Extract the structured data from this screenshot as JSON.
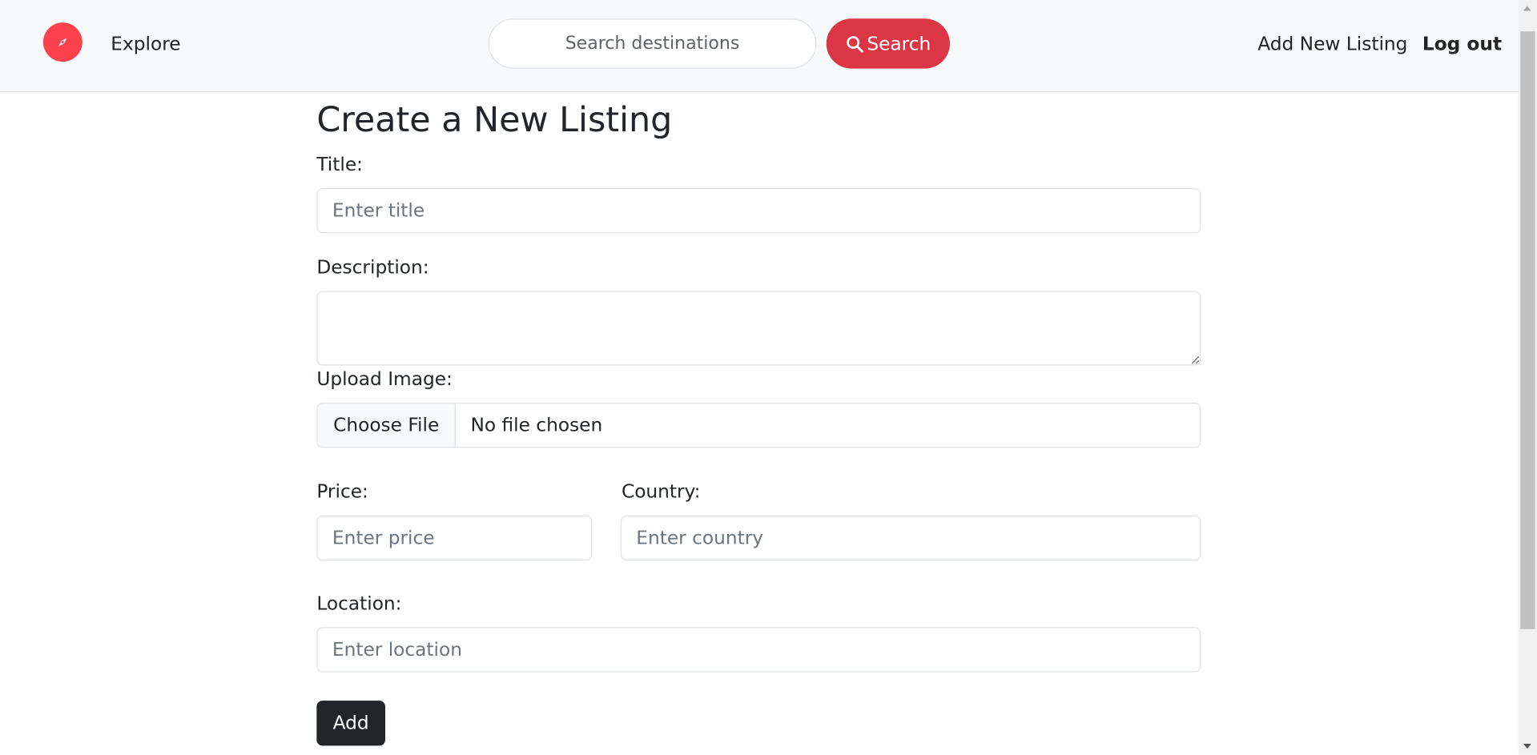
{
  "navbar": {
    "explore_label": "Explore",
    "search_placeholder": "Search destinations",
    "search_button_label": "Search",
    "add_listing_label": "Add New Listing",
    "logout_label": "Log out",
    "brand_icon": "compass-icon"
  },
  "form": {
    "heading": "Create a New Listing",
    "title_label": "Title:",
    "title_placeholder": "Enter title",
    "description_label": "Description:",
    "description_value": "",
    "image_label": "Upload Image:",
    "choose_file_label": "Choose File",
    "file_status": "No file chosen",
    "price_label": "Price:",
    "price_placeholder": "Enter price",
    "country_label": "Country:",
    "country_placeholder": "Enter country",
    "location_label": "Location:",
    "location_placeholder": "Enter location",
    "submit_label": "Add"
  },
  "colors": {
    "brand": "#fe424d",
    "search_button": "#dc3545",
    "submit_button": "#212529",
    "navbar_bg": "#f8f9fa"
  }
}
